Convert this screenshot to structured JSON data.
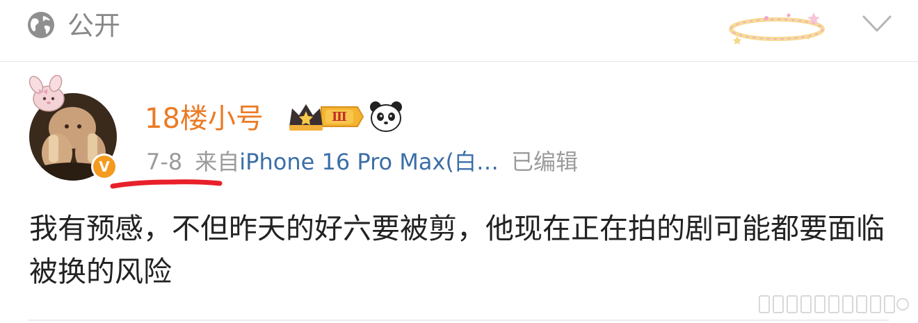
{
  "visibility": {
    "icon": "globe-icon",
    "label": "公开"
  },
  "post": {
    "author": {
      "name": "18楼小号",
      "vip_level": "Ⅲ",
      "verified_mark": "V",
      "emoji": "panda"
    },
    "date": "7-8",
    "from_prefix": "来自",
    "source": "iPhone 16 Pro Max(白…",
    "edited": "已编辑",
    "text": "我有预感，不但昨天的好六要被剪，他现在正在拍的剧可能都要面临被换的风险"
  },
  "colors": {
    "username": "#eb7a24",
    "source_link": "#3b6ea8",
    "meta_gray": "#9b9b9b",
    "annotation_red": "#e8202a"
  }
}
